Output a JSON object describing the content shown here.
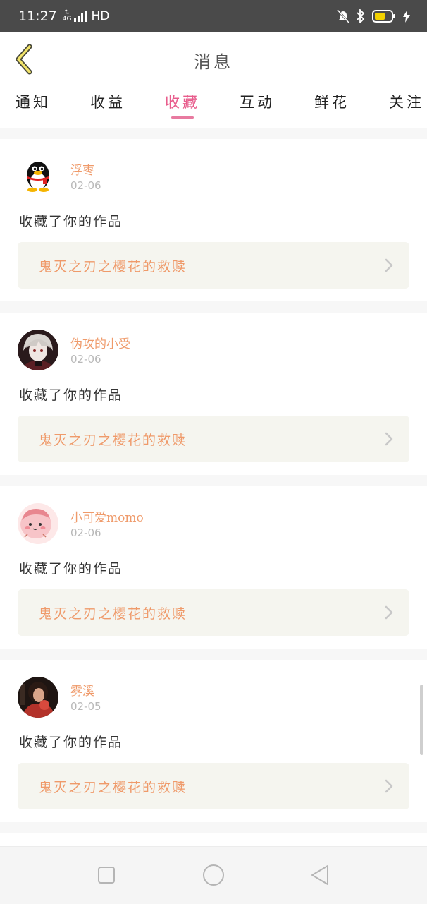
{
  "status_bar": {
    "time": "11:27",
    "network": "4G",
    "quality": "HD",
    "icons": [
      "data-arrows-icon",
      "signal-icon",
      "mute-icon",
      "bluetooth-icon",
      "battery-icon",
      "charging-icon"
    ],
    "battery_color": "#f2d100"
  },
  "header": {
    "back_icon": "back-chevron-icon",
    "title": "消息"
  },
  "tabs": [
    {
      "label": "通知"
    },
    {
      "label": "收益"
    },
    {
      "label": "收藏"
    },
    {
      "label": "互动"
    },
    {
      "label": "鲜花"
    },
    {
      "label": "关注"
    }
  ],
  "active_tab": "收藏",
  "colors": {
    "accent_pink": "#e85c8c",
    "username_orange": "#ef9a6a",
    "work_bg": "#f5f5ef"
  },
  "notifications": [
    {
      "username": "浮枣",
      "date": "02-06",
      "message": "收藏了你的作品",
      "work_title": "鬼灭之刃之樱花的救赎",
      "avatar": "qq-penguin-avatar"
    },
    {
      "username": "伪攻的小受",
      "date": "02-06",
      "message": "收藏了你的作品",
      "work_title": "鬼灭之刃之樱花的救赎",
      "avatar": "anime-character-avatar"
    },
    {
      "username": "小可爱momo",
      "date": "02-06",
      "message": "收藏了你的作品",
      "work_title": "鬼灭之刃之樱花的救赎",
      "avatar": "pink-cartoon-avatar"
    },
    {
      "username": "雾溪",
      "date": "02-05",
      "message": "收藏了你的作品",
      "work_title": "鬼灭之刃之樱花的救赎",
      "avatar": "photo-avatar"
    }
  ],
  "nav": {
    "icons": [
      "recent-apps-icon",
      "home-icon",
      "back-icon"
    ]
  }
}
